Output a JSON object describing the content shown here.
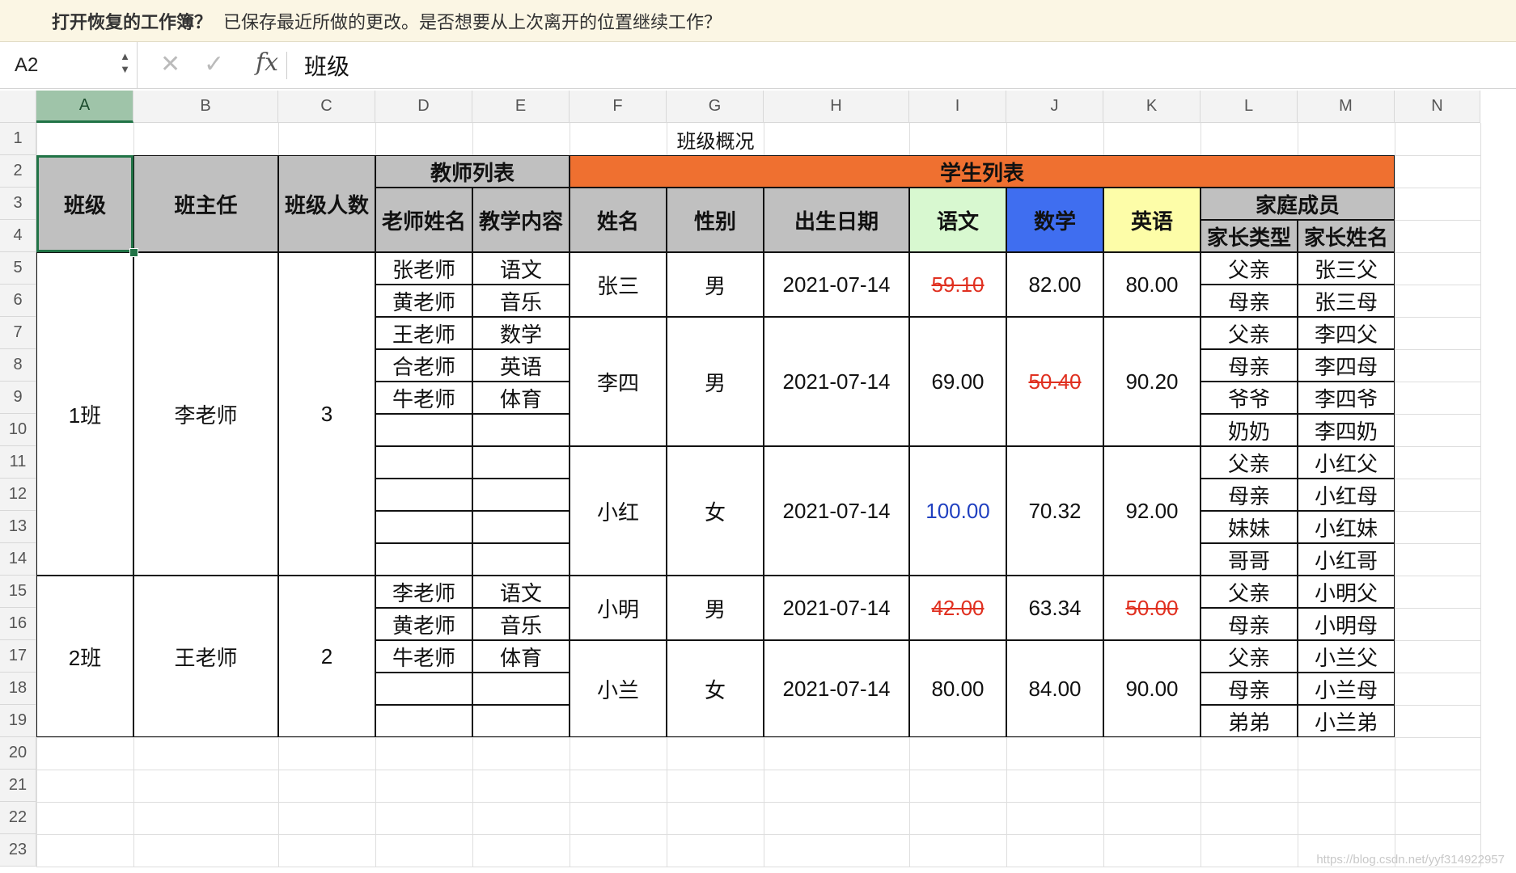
{
  "banner": {
    "question": "打开恢复的工作簿？",
    "message": "已保存最近所做的更改。是否想要从上次离开的位置继续工作？"
  },
  "formula_bar": {
    "name_box": "A2",
    "cancel_icon": "✕",
    "confirm_icon": "✓",
    "fx_label": "fx",
    "value": "班级"
  },
  "columns": [
    "A",
    "B",
    "C",
    "D",
    "E",
    "F",
    "G",
    "H",
    "I",
    "J",
    "K",
    "L",
    "M",
    "N"
  ],
  "rows": [
    "1",
    "2",
    "3",
    "4",
    "5",
    "6",
    "7",
    "8",
    "9",
    "10",
    "11",
    "12",
    "13",
    "14",
    "15",
    "16",
    "17",
    "18",
    "19",
    "20",
    "21",
    "22",
    "23"
  ],
  "selected_cell": "A2",
  "colors": {
    "header_gray": "#c0c0c0",
    "student_header": "#ef7030",
    "chinese_header": "#d8f8d0",
    "math_header": "#3f6ef0",
    "english_header": "#fdfda8",
    "low_score": "#e03020",
    "high_score": "#2040c0",
    "selection": "#217346"
  },
  "sheet": {
    "title": "班级概况",
    "headers": {
      "class": "班级",
      "head_teacher": "班主任",
      "class_size": "班级人数",
      "teacher_list": "教师列表",
      "teacher_name": "老师姓名",
      "subject": "教学内容",
      "student_list": "学生列表",
      "name": "姓名",
      "gender": "性别",
      "birth": "出生日期",
      "chinese": "语文",
      "math": "数学",
      "english": "英语",
      "family": "家庭成员",
      "parent_type": "家长类型",
      "parent_name": "家长姓名"
    },
    "classes": [
      {
        "name": "1班",
        "head_teacher": "李老师",
        "size": "3"
      },
      {
        "name": "2班",
        "head_teacher": "王老师",
        "size": "2"
      }
    ],
    "teachers": [
      {
        "name": "张老师",
        "subject": "语文"
      },
      {
        "name": "黄老师",
        "subject": "音乐"
      },
      {
        "name": "王老师",
        "subject": "数学"
      },
      {
        "name": "合老师",
        "subject": "英语"
      },
      {
        "name": "牛老师",
        "subject": "体育"
      },
      {
        "name": "李老师",
        "subject": "语文"
      },
      {
        "name": "黄老师",
        "subject": "音乐"
      },
      {
        "name": "牛老师",
        "subject": "体育"
      }
    ],
    "students": [
      {
        "name": "张三",
        "gender": "男",
        "birth": "2021-07-14",
        "chinese": "59.10",
        "math": "82.00",
        "english": "80.00"
      },
      {
        "name": "李四",
        "gender": "男",
        "birth": "2021-07-14",
        "chinese": "69.00",
        "math": "50.40",
        "english": "90.20"
      },
      {
        "name": "小红",
        "gender": "女",
        "birth": "2021-07-14",
        "chinese": "100.00",
        "math": "70.32",
        "english": "92.00"
      },
      {
        "name": "小明",
        "gender": "男",
        "birth": "2021-07-14",
        "chinese": "42.00",
        "math": "63.34",
        "english": "50.00"
      },
      {
        "name": "小兰",
        "gender": "女",
        "birth": "2021-07-14",
        "chinese": "80.00",
        "math": "84.00",
        "english": "90.00"
      }
    ],
    "family": [
      {
        "type": "父亲",
        "name": "张三父"
      },
      {
        "type": "母亲",
        "name": "张三母"
      },
      {
        "type": "父亲",
        "name": "李四父"
      },
      {
        "type": "母亲",
        "name": "李四母"
      },
      {
        "type": "爷爷",
        "name": "李四爷"
      },
      {
        "type": "奶奶",
        "name": "李四奶"
      },
      {
        "type": "父亲",
        "name": "小红父"
      },
      {
        "type": "母亲",
        "name": "小红母"
      },
      {
        "type": "妹妹",
        "name": "小红妹"
      },
      {
        "type": "哥哥",
        "name": "小红哥"
      },
      {
        "type": "父亲",
        "name": "小明父"
      },
      {
        "type": "母亲",
        "name": "小明母"
      },
      {
        "type": "父亲",
        "name": "小兰父"
      },
      {
        "type": "母亲",
        "name": "小兰母"
      },
      {
        "type": "弟弟",
        "name": "小兰弟"
      }
    ]
  },
  "watermark": "https://blog.csdn.net/yyf314922957"
}
